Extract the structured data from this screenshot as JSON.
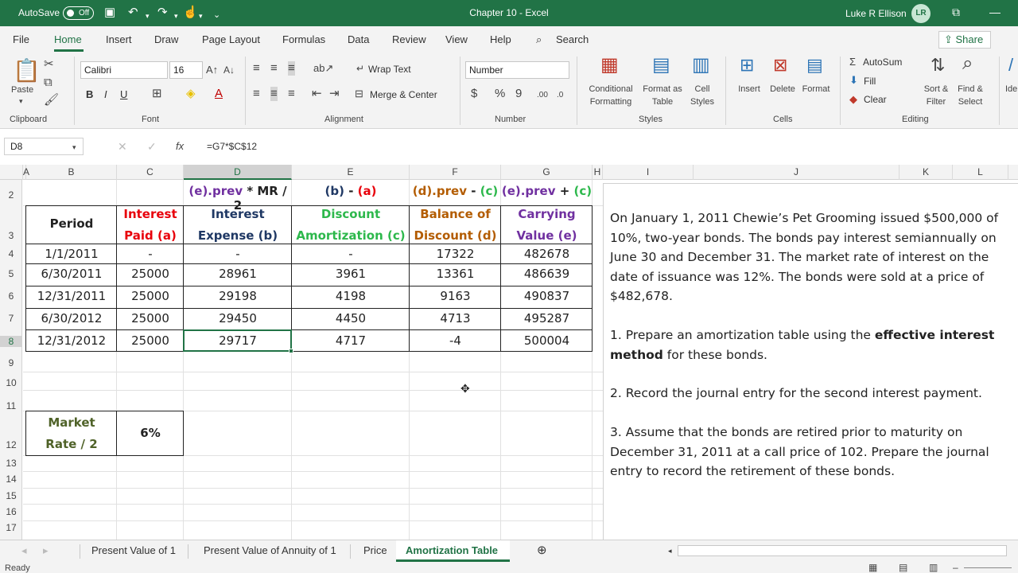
{
  "title_bar": {
    "autosave_label": "AutoSave",
    "autosave_state": "Off",
    "title": "Chapter 10  -  Excel",
    "user_name": "Luke R Ellison",
    "user_initials": "LR"
  },
  "menu": {
    "tabs": [
      "File",
      "Home",
      "Insert",
      "Draw",
      "Page Layout",
      "Formulas",
      "Data",
      "Review",
      "View",
      "Help"
    ],
    "search": "Search",
    "share": "Share",
    "active_tab": "Home"
  },
  "ribbon": {
    "clipboard": {
      "paste": "Paste",
      "label": "Clipboard"
    },
    "font": {
      "name": "Calibri",
      "size": "16",
      "bold": "B",
      "italic": "I",
      "underline": "U",
      "label": "Font"
    },
    "alignment": {
      "wrap_text": "Wrap Text",
      "merge_center": "Merge & Center",
      "label": "Alignment"
    },
    "number": {
      "format": "Number",
      "label": "Number"
    },
    "styles": {
      "conditional_1": "Conditional",
      "conditional_2": "Formatting",
      "format_table_1": "Format as",
      "format_table_2": "Table",
      "cell_styles_1": "Cell",
      "cell_styles_2": "Styles",
      "label": "Styles"
    },
    "cells": {
      "insert": "Insert",
      "delete": "Delete",
      "format": "Format",
      "label": "Cells"
    },
    "editing": {
      "autosum": "AutoSum",
      "fill": "Fill",
      "clear": "Clear",
      "sort_1": "Sort &",
      "sort_2": "Filter",
      "find_1": "Find &",
      "find_2": "Select",
      "label": "Editing"
    },
    "ideas_partial": "Ide"
  },
  "formula_bar": {
    "name_box": "D8",
    "formula": "=G7*$C$12"
  },
  "columns": [
    "A",
    "B",
    "C",
    "D",
    "E",
    "F",
    "G",
    "H",
    "I",
    "J",
    "K",
    "L"
  ],
  "rows": [
    "2",
    "3",
    "4",
    "5",
    "6",
    "7",
    "8",
    "9",
    "10",
    "11",
    "12",
    "13",
    "14",
    "15",
    "16",
    "17"
  ],
  "sheet": {
    "row2": {
      "d": "(e).prev",
      "d_op": " * MR / 2",
      "e_a": "(b)",
      "e_op": " - ",
      "e_b": "(a)",
      "f_a": "(d).prev",
      "f_op": " - ",
      "f_b": "(c)",
      "g_a": "(e).prev",
      "g_op": " + ",
      "g_b": "(c)"
    },
    "headers": {
      "b": "Period",
      "c1": "Interest",
      "c2": "Paid (a)",
      "d1": "Interest",
      "d2": "Expense (b)",
      "e1": "Discount",
      "e2": "Amortization (c)",
      "f1": "Balance of",
      "f2": "Discount (d)",
      "g1": "Carrying",
      "g2": "Value (e)"
    },
    "table_rows": [
      [
        "1/1/2011",
        "-",
        "-",
        "-",
        "17322",
        "482678"
      ],
      [
        "6/30/2011",
        "25000",
        "28961",
        "3961",
        "13361",
        "486639"
      ],
      [
        "12/31/2011",
        "25000",
        "29198",
        "4198",
        "9163",
        "490837"
      ],
      [
        "6/30/2012",
        "25000",
        "29450",
        "4450",
        "4713",
        "495287"
      ],
      [
        "12/31/2012",
        "25000",
        "29717",
        "4717",
        "-4",
        "500004"
      ]
    ],
    "market_rate_label_1": "Market",
    "market_rate_label_2": "Rate / 2",
    "market_rate_value": "6%"
  },
  "problem_text": {
    "intro": "On January 1, 2011 Chewie’s Pet Grooming issued $500,000 of 10%, two-year bonds.  The bonds pay interest semiannually on June 30 and December 31.  The market rate of interest on the date of issuance was 12%. The bonds were sold at a price of $482,678.",
    "q1_pre": "1. Prepare an amortization table using the ",
    "q1_bold": "effective interest method",
    "q1_post": " for these bonds.",
    "q2": "2. Record the journal entry for the second interest payment.",
    "q3": "3. Assume that the bonds are retired prior to maturity on December 31, 2011 at a call price of 102. Prepare the journal entry to record the retirement of these bonds."
  },
  "sheet_tabs": [
    "Present Value of 1",
    "Present Value of Annuity of 1",
    "Price",
    "Amortization Table"
  ],
  "active_sheet": "Amortization Table",
  "status": "Ready",
  "colors": {
    "excel_green": "#217346",
    "red": "#e8000b",
    "navy": "#1f3864",
    "green": "#2db84c",
    "brown": "#b35c00",
    "purple": "#7030a0",
    "olive": "#4f6228"
  }
}
